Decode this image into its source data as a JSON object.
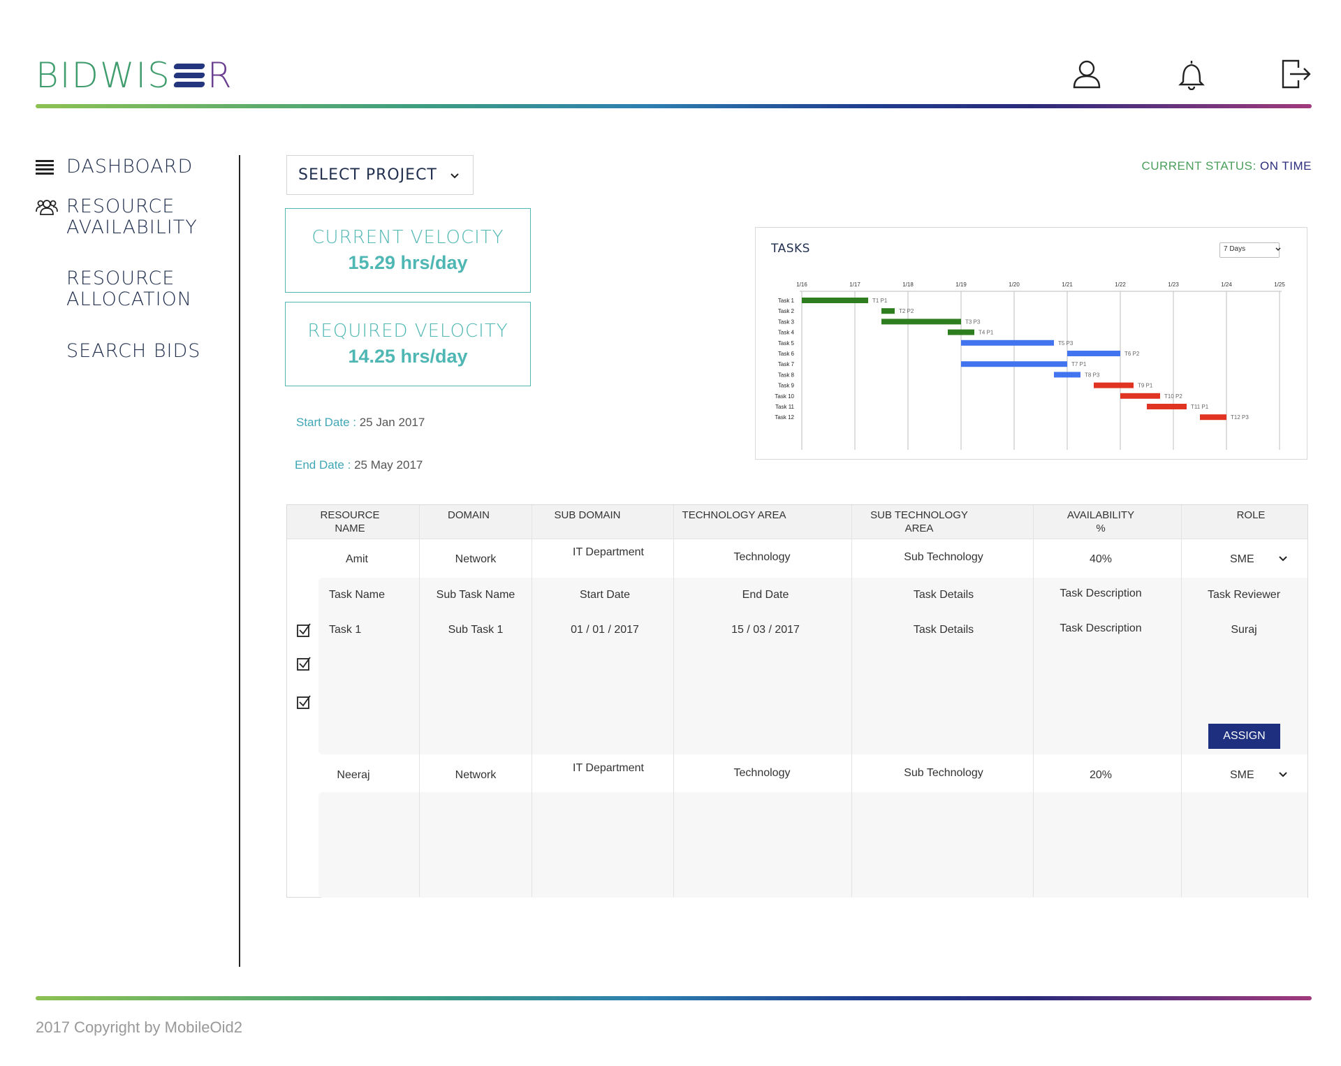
{
  "brand": {
    "logo_part1": "BIDWIS",
    "logo_part2": "R"
  },
  "header_icons": [
    "user-icon",
    "bell-icon",
    "logout-icon"
  ],
  "sidebar": {
    "items": [
      {
        "label": "DASHBOARD",
        "icon": "menu-icon"
      },
      {
        "label": "RESOURCE AVAILABILITY",
        "icon": "users-icon"
      },
      {
        "label": "RESOURCE ALLOCATION",
        "icon": ""
      },
      {
        "label": "SEARCH BIDS",
        "icon": ""
      }
    ]
  },
  "project_select": {
    "label": "SELECT PROJECT"
  },
  "status": {
    "label": "CURRENT STATUS:",
    "value": "ON TIME"
  },
  "velocity": {
    "current": {
      "title": "CURRENT VELOCITY",
      "value": "15.29 hrs/day"
    },
    "required": {
      "title": "REQUIRED VELOCITY",
      "value": "14.25 hrs/day"
    }
  },
  "dates": {
    "start_label": "Start Date :",
    "start_value": "25 Jan 2017",
    "end_label": "End Date :",
    "end_value": "25 May 2017"
  },
  "tasks_chart": {
    "title": "TASKS",
    "range_select": "7 Days",
    "chart_data": {
      "type": "gantt",
      "x_ticks": [
        "1/16",
        "1/17",
        "1/18",
        "1/19",
        "1/20",
        "1/21",
        "1/22",
        "1/23",
        "1/24",
        "1/25"
      ],
      "tasks": [
        {
          "name": "Task 1",
          "start": 0.0,
          "end": 1.25,
          "label": "T1 P1",
          "priority": 1
        },
        {
          "name": "Task 2",
          "start": 1.5,
          "end": 1.75,
          "label": "T2 P2",
          "priority": 1
        },
        {
          "name": "Task 3",
          "start": 1.5,
          "end": 3.0,
          "label": "T3 P3",
          "priority": 1
        },
        {
          "name": "Task 4",
          "start": 2.75,
          "end": 3.25,
          "label": "T4 P1",
          "priority": 1
        },
        {
          "name": "Task 5",
          "start": 3.0,
          "end": 4.75,
          "label": "T5 P3",
          "priority": 2
        },
        {
          "name": "Task 6",
          "start": 5.0,
          "end": 6.0,
          "label": "T6 P2",
          "priority": 2
        },
        {
          "name": "Task 7",
          "start": 3.0,
          "end": 5.0,
          "label": "T7 P1",
          "priority": 2
        },
        {
          "name": "Task 8",
          "start": 4.75,
          "end": 5.25,
          "label": "T8 P3",
          "priority": 2
        },
        {
          "name": "Task 9",
          "start": 5.5,
          "end": 6.25,
          "label": "T9 P1",
          "priority": 3
        },
        {
          "name": "Task 10",
          "start": 6.0,
          "end": 6.75,
          "label": "T10 P2",
          "priority": 3
        },
        {
          "name": "Task 11",
          "start": 6.5,
          "end": 7.25,
          "label": "T11 P1",
          "priority": 3
        },
        {
          "name": "Task 12",
          "start": 7.5,
          "end": 8.0,
          "label": "T12 P3",
          "priority": 3
        }
      ],
      "priority_colors": {
        "1": "#2e7d1f",
        "2": "#4274f0",
        "3": "#e03321"
      }
    }
  },
  "table": {
    "headers": [
      "RESOURCE NAME",
      "DOMAIN",
      "SUB DOMAIN",
      "TECHNOLOGY AREA",
      "SUB TECHNOLOGY AREA",
      "AVAILABILITY %",
      "ROLE"
    ],
    "rows": [
      {
        "name": "Amit",
        "domain": "Network",
        "subdomain": "IT Department",
        "tech": "Technology",
        "subtech": "Sub Technology",
        "availability": "40%",
        "role": "SME"
      },
      {
        "name": "Neeraj",
        "domain": "Network",
        "subdomain": "IT Department",
        "tech": "Technology",
        "subtech": "Sub Technology",
        "availability": "20%",
        "role": "SME"
      }
    ],
    "task_headers": [
      "Task Name",
      "Sub Task Name",
      "Start Date",
      "End Date",
      "Task Details",
      "Task Description",
      "Task Reviewer"
    ],
    "task_rows": [
      {
        "task": "Task 1",
        "subtask": "Sub Task 1",
        "start": "01 / 01 / 2017",
        "end": "15 / 03 / 2017",
        "details": "Task Details",
        "description": "Task Description",
        "reviewer": "Suraj"
      }
    ],
    "assign_label": "ASSIGN"
  },
  "footer": {
    "copyright": "2017 Copyright by MobileOid2"
  }
}
